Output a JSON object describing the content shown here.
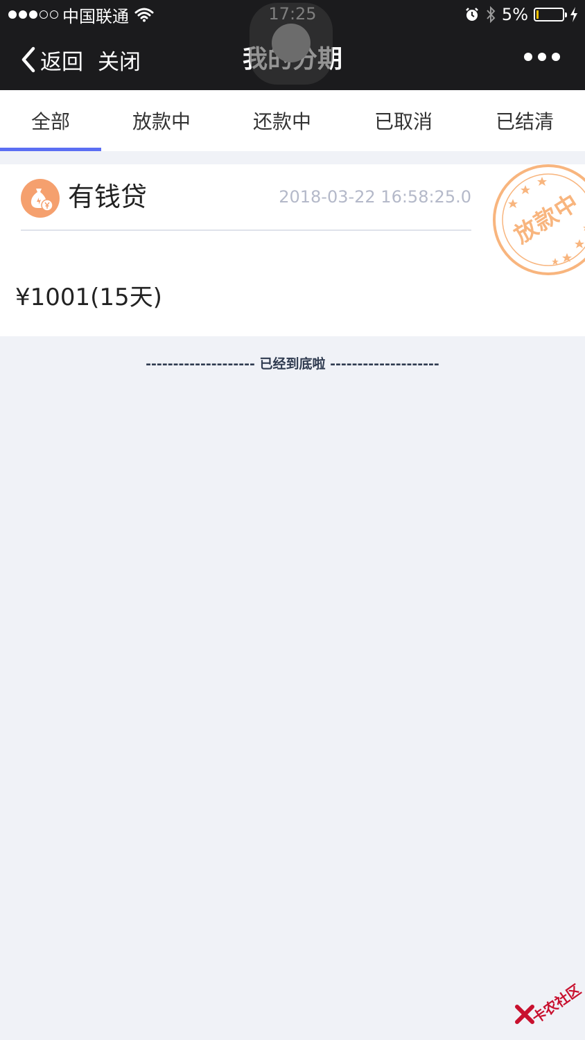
{
  "status_bar": {
    "carrier": "中国联通",
    "time": "17:25",
    "battery_percent": "5%",
    "battery_level": 0.05,
    "signal_bars": 3,
    "signal_total": 5,
    "icons": [
      "wifi-icon",
      "alarm-icon",
      "bluetooth-icon",
      "battery-icon",
      "charging-icon"
    ]
  },
  "nav": {
    "back_label": "返回",
    "close_label": "关闭",
    "title": "我的分期"
  },
  "tabs": [
    {
      "label": "全部",
      "active": true
    },
    {
      "label": "放款中",
      "active": false
    },
    {
      "label": "还款中",
      "active": false
    },
    {
      "label": "已取消",
      "active": false
    },
    {
      "label": "已结清",
      "active": false
    }
  ],
  "loan": {
    "name": "有钱贷",
    "time": "2018-03-22 16:58:25.0",
    "amount": "¥1001(15天)",
    "stamp": "放款中",
    "icon": "money-bag-icon"
  },
  "end_text": "-------------------- 已经到底啦 --------------------",
  "watermark": "卡农社区",
  "colors": {
    "header_bg": "#1b1b1d",
    "accent": "#5b6ef3",
    "stamp": "#f8b57e",
    "page_bg": "#f0f2f7",
    "loan_icon": "#f5a06e"
  }
}
